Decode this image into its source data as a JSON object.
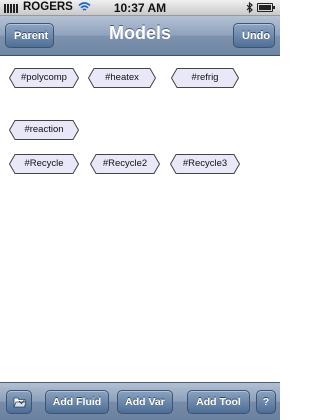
{
  "status_bar": {
    "carrier": "ROGERS",
    "time": "10:37 AM",
    "icons": [
      "signal-icon",
      "wifi-icon",
      "bluetooth-icon",
      "battery-icon"
    ]
  },
  "nav_bar": {
    "title": "Models",
    "left_button": "Parent",
    "right_button": "Undo"
  },
  "models": [
    {
      "label": "#polycomp"
    },
    {
      "label": "#heatex"
    },
    {
      "label": "#refrig"
    },
    {
      "label": "#reaction"
    },
    {
      "label": "#Recycle"
    },
    {
      "label": "#Recycle2"
    },
    {
      "label": "#Recycle3"
    }
  ],
  "toolbar": {
    "open_icon": "folder-open-icon",
    "add_fluid": "Add Fluid",
    "add_var": "Add Var",
    "add_tool": "Add Tool",
    "help": "?"
  },
  "colors": {
    "nav_bar": "#8fa2bc",
    "tag_fill": "#e8e8f8",
    "tag_border": "#444444"
  }
}
